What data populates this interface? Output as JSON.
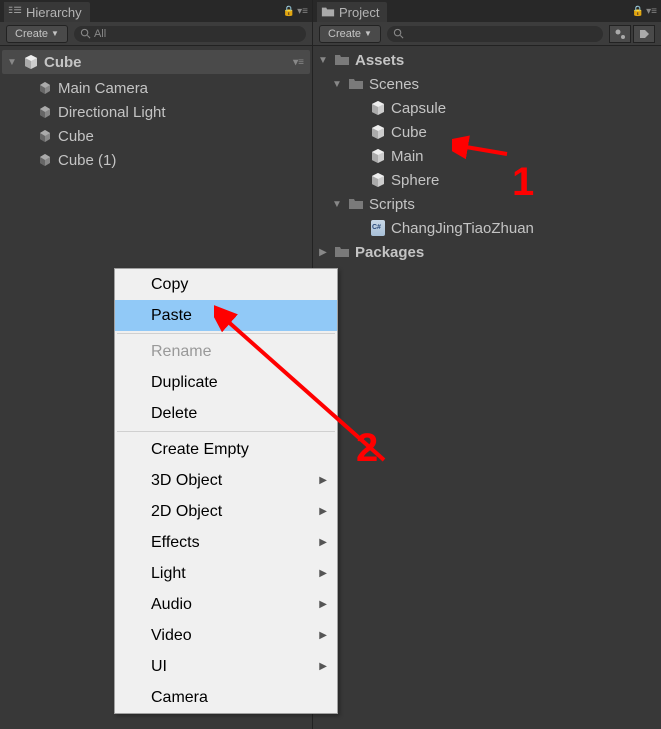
{
  "hierarchy": {
    "tab_label": "Hierarchy",
    "create_label": "Create",
    "search_placeholder": "All",
    "scene_name": "Cube",
    "items": [
      {
        "label": "Main Camera",
        "icon": "cube"
      },
      {
        "label": "Directional Light",
        "icon": "cube"
      },
      {
        "label": "Cube",
        "icon": "cube"
      },
      {
        "label": "Cube (1)",
        "icon": "cube"
      }
    ]
  },
  "project": {
    "tab_label": "Project",
    "create_label": "Create",
    "search_placeholder": "",
    "tree": {
      "assets_label": "Assets",
      "scenes_label": "Scenes",
      "scenes_items": [
        {
          "label": "Capsule"
        },
        {
          "label": "Cube"
        },
        {
          "label": "Main"
        },
        {
          "label": "Sphere"
        }
      ],
      "scripts_label": "Scripts",
      "scripts_items": [
        {
          "label": "ChangJingTiaoZhuan"
        }
      ],
      "packages_label": "Packages"
    }
  },
  "context_menu": {
    "items": [
      {
        "label": "Copy",
        "type": "item"
      },
      {
        "label": "Paste",
        "type": "item",
        "highlighted": true
      },
      {
        "type": "sep"
      },
      {
        "label": "Rename",
        "type": "item",
        "disabled": true
      },
      {
        "label": "Duplicate",
        "type": "item"
      },
      {
        "label": "Delete",
        "type": "item"
      },
      {
        "type": "sep"
      },
      {
        "label": "Create Empty",
        "type": "item"
      },
      {
        "label": "3D Object",
        "type": "item",
        "submenu": true
      },
      {
        "label": "2D Object",
        "type": "item",
        "submenu": true
      },
      {
        "label": "Effects",
        "type": "item",
        "submenu": true
      },
      {
        "label": "Light",
        "type": "item",
        "submenu": true
      },
      {
        "label": "Audio",
        "type": "item",
        "submenu": true
      },
      {
        "label": "Video",
        "type": "item",
        "submenu": true
      },
      {
        "label": "UI",
        "type": "item",
        "submenu": true
      },
      {
        "label": "Camera",
        "type": "item"
      }
    ]
  },
  "annotations": {
    "label1": "1",
    "label2": "2"
  }
}
